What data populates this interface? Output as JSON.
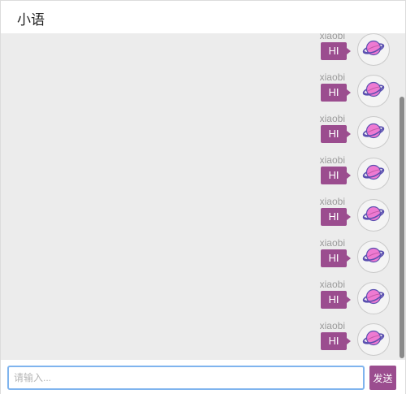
{
  "header": {
    "title": "小语"
  },
  "messages": [
    {
      "user": "xiaobi",
      "text": "HI",
      "avatar_icon": "planet-icon"
    },
    {
      "user": "xiaobi",
      "text": "HI",
      "avatar_icon": "planet-icon"
    },
    {
      "user": "xiaobi",
      "text": "HI",
      "avatar_icon": "planet-icon"
    },
    {
      "user": "xiaobi",
      "text": "HI",
      "avatar_icon": "planet-icon"
    },
    {
      "user": "xiaobi",
      "text": "HI",
      "avatar_icon": "planet-icon"
    },
    {
      "user": "xiaobi",
      "text": "HI",
      "avatar_icon": "planet-icon"
    },
    {
      "user": "xiaobi",
      "text": "HI",
      "avatar_icon": "planet-icon"
    },
    {
      "user": "xiaobi",
      "text": "HI",
      "avatar_icon": "planet-icon"
    }
  ],
  "composer": {
    "placeholder": "请输入...",
    "value": "",
    "send_label": "发送"
  },
  "colors": {
    "accent": "#9b4d8f",
    "background": "#ececec",
    "input_focus": "#7fb4ee",
    "planet": "#ee7ad2"
  }
}
